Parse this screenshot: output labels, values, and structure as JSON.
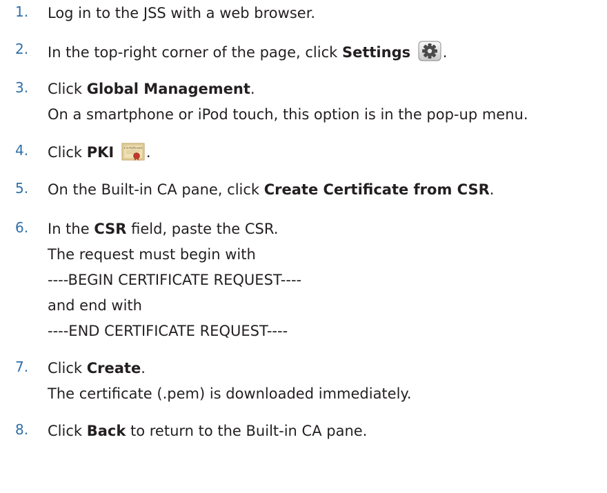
{
  "steps": [
    {
      "number": "1.",
      "text": "Log in to the JSS with a web browser."
    },
    {
      "number": "2.",
      "pre": "In the top-right corner of the page, click ",
      "bold": "Settings",
      "post": ".",
      "icon": "gear-icon"
    },
    {
      "number": "3.",
      "pre": "Click ",
      "bold": "Global Management",
      "post": ".",
      "sub": [
        "On a smartphone or iPod touch, this option is in the pop-up menu."
      ]
    },
    {
      "number": "4.",
      "pre": "Click ",
      "bold": "PKI",
      "post": ".",
      "icon": "certificate-icon",
      "icon_text": "Certificate"
    },
    {
      "number": "5.",
      "pre": "On the Built-in CA pane, click ",
      "bold": "Create Certificate from CSR",
      "post": "."
    },
    {
      "number": "6.",
      "pre": "In the ",
      "bold": "CSR",
      "post": " field, paste the CSR.",
      "sub": [
        "The request must begin with",
        "----BEGIN CERTIFICATE REQUEST----",
        "and end with",
        "----END CERTIFICATE REQUEST----"
      ]
    },
    {
      "number": "7.",
      "pre": "Click ",
      "bold": "Create",
      "post": ".",
      "sub": [
        "The certificate (.pem) is downloaded immediately."
      ]
    },
    {
      "number": "8.",
      "pre": "Click ",
      "bold": "Back",
      "post": " to return to the Built-in CA pane."
    }
  ]
}
